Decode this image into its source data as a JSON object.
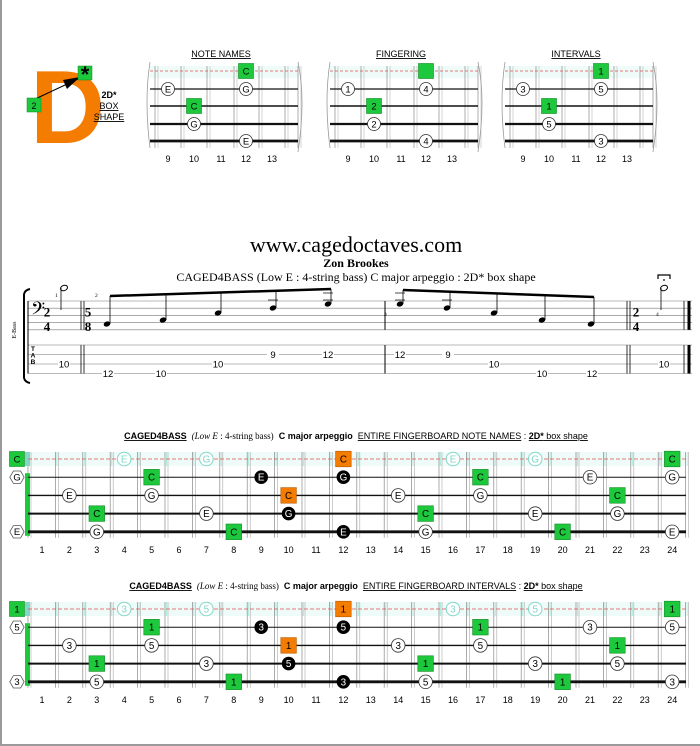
{
  "logo": {
    "letter": "D",
    "star": "*",
    "finger": "2",
    "shape_label": "2D*",
    "shape_sub1": "BOX",
    "shape_sub2": "SHAPE",
    "colors": {
      "letter": "#f47c00",
      "box": "#1ec83c"
    }
  },
  "mini_diagrams": {
    "frets": [
      "9",
      "10",
      "11",
      "12",
      "13"
    ],
    "panels": [
      {
        "title": "NOTE NAMES",
        "marks": [
          {
            "fret": 12,
            "string": 0,
            "text": "C",
            "style": "green"
          },
          {
            "fret": 9,
            "string": 1,
            "text": "E",
            "style": "circle"
          },
          {
            "fret": 12,
            "string": 1,
            "text": "G",
            "style": "circle"
          },
          {
            "fret": 10,
            "string": 2,
            "text": "C",
            "style": "green"
          },
          {
            "fret": 10,
            "string": 3,
            "text": "G",
            "style": "circle"
          },
          {
            "fret": 12,
            "string": 4,
            "text": "E",
            "style": "circle"
          }
        ]
      },
      {
        "title": "FINGERING",
        "marks": [
          {
            "fret": 12,
            "string": 0,
            "text": "",
            "style": "green"
          },
          {
            "fret": 9,
            "string": 1,
            "text": "1",
            "style": "circle"
          },
          {
            "fret": 12,
            "string": 1,
            "text": "4",
            "style": "circle"
          },
          {
            "fret": 10,
            "string": 2,
            "text": "2",
            "style": "green"
          },
          {
            "fret": 10,
            "string": 3,
            "text": "2",
            "style": "circle"
          },
          {
            "fret": 12,
            "string": 4,
            "text": "4",
            "style": "circle"
          }
        ]
      },
      {
        "title": "INTERVALS",
        "marks": [
          {
            "fret": 12,
            "string": 0,
            "text": "1",
            "style": "green"
          },
          {
            "fret": 9,
            "string": 1,
            "text": "3",
            "style": "circle"
          },
          {
            "fret": 12,
            "string": 1,
            "text": "5",
            "style": "circle"
          },
          {
            "fret": 10,
            "string": 2,
            "text": "1",
            "style": "green"
          },
          {
            "fret": 10,
            "string": 3,
            "text": "5",
            "style": "circle"
          },
          {
            "fret": 12,
            "string": 4,
            "text": "3",
            "style": "circle"
          }
        ]
      }
    ]
  },
  "header": {
    "site": "www.cagedoctaves.com",
    "author": "Zon Brookes",
    "subtitle": "CAGED4BASS (Low E : 4-string bass) C major arpeggio : 2D* box shape"
  },
  "score": {
    "instrument": "E-Bass",
    "tab_clef": [
      "T",
      "A",
      "B"
    ],
    "measures": [
      {
        "number": "1",
        "time": [
          "2",
          "4"
        ],
        "tab": [
          {
            "string": 2,
            "fret": "10"
          }
        ]
      },
      {
        "number": "2",
        "time": [
          "5",
          "8"
        ],
        "tab": [
          {
            "string": 3,
            "fret": "12"
          },
          {
            "string": 3,
            "fret": "10"
          },
          {
            "string": 2,
            "fret": "10"
          },
          {
            "string": 1,
            "fret": "9"
          },
          {
            "string": 1,
            "fret": "12"
          }
        ]
      },
      {
        "number": "3",
        "time": null,
        "tab": [
          {
            "string": 1,
            "fret": "12"
          },
          {
            "string": 1,
            "fret": "9"
          },
          {
            "string": 2,
            "fret": "10"
          },
          {
            "string": 3,
            "fret": "10"
          },
          {
            "string": 3,
            "fret": "12"
          }
        ]
      },
      {
        "number": "4",
        "time": [
          "2",
          "4"
        ],
        "tab": [
          {
            "string": 2,
            "fret": "10"
          }
        ]
      }
    ]
  },
  "fingerboards": [
    {
      "title_parts": {
        "a": "CAGED4BASS",
        "b": "(Low E",
        "c": " : 4-string bass)",
        "d": "C major arpeggio",
        "e": "ENTIRE FINGERBOARD  NOTE NAMES",
        "f": " : ",
        "g": "2D*",
        "h": " box shape"
      },
      "open": [
        {
          "string": 0,
          "text": "C",
          "style": "green"
        },
        {
          "string": 1,
          "text": "G",
          "style": "hex"
        },
        {
          "string": 4,
          "text": "E",
          "style": "hex"
        }
      ],
      "marks": [
        {
          "fret": 4,
          "string": 0,
          "text": "E",
          "style": "ghost"
        },
        {
          "fret": 7,
          "string": 0,
          "text": "G",
          "style": "ghost"
        },
        {
          "fret": 12,
          "string": 0,
          "text": "C",
          "style": "orange"
        },
        {
          "fret": 16,
          "string": 0,
          "text": "E",
          "style": "ghost"
        },
        {
          "fret": 19,
          "string": 0,
          "text": "G",
          "style": "ghost"
        },
        {
          "fret": 24,
          "string": 0,
          "text": "C",
          "style": "green"
        },
        {
          "fret": 5,
          "string": 1,
          "text": "C",
          "style": "green"
        },
        {
          "fret": 9,
          "string": 1,
          "text": "E",
          "style": "black"
        },
        {
          "fret": 12,
          "string": 1,
          "text": "G",
          "style": "black"
        },
        {
          "fret": 17,
          "string": 1,
          "text": "C",
          "style": "green"
        },
        {
          "fret": 21,
          "string": 1,
          "text": "E",
          "style": "circle"
        },
        {
          "fret": 24,
          "string": 1,
          "text": "G",
          "style": "circle"
        },
        {
          "fret": 2,
          "string": 2,
          "text": "E",
          "style": "circle"
        },
        {
          "fret": 5,
          "string": 2,
          "text": "G",
          "style": "circle"
        },
        {
          "fret": 10,
          "string": 2,
          "text": "C",
          "style": "orange"
        },
        {
          "fret": 14,
          "string": 2,
          "text": "E",
          "style": "circle"
        },
        {
          "fret": 17,
          "string": 2,
          "text": "G",
          "style": "circle"
        },
        {
          "fret": 22,
          "string": 2,
          "text": "C",
          "style": "green"
        },
        {
          "fret": 3,
          "string": 3,
          "text": "C",
          "style": "green"
        },
        {
          "fret": 7,
          "string": 3,
          "text": "E",
          "style": "circle"
        },
        {
          "fret": 10,
          "string": 3,
          "text": "G",
          "style": "black"
        },
        {
          "fret": 15,
          "string": 3,
          "text": "C",
          "style": "green"
        },
        {
          "fret": 19,
          "string": 3,
          "text": "E",
          "style": "circle"
        },
        {
          "fret": 22,
          "string": 3,
          "text": "G",
          "style": "circle"
        },
        {
          "fret": 3,
          "string": 4,
          "text": "G",
          "style": "circle"
        },
        {
          "fret": 8,
          "string": 4,
          "text": "C",
          "style": "green"
        },
        {
          "fret": 12,
          "string": 4,
          "text": "E",
          "style": "black"
        },
        {
          "fret": 15,
          "string": 4,
          "text": "G",
          "style": "circle"
        },
        {
          "fret": 20,
          "string": 4,
          "text": "C",
          "style": "green"
        },
        {
          "fret": 24,
          "string": 4,
          "text": "E",
          "style": "circle"
        }
      ]
    },
    {
      "title_parts": {
        "a": "CAGED4BASS",
        "b": "(Low E",
        "c": " : 4-string bass)",
        "d": "C major arpeggio",
        "e": "ENTIRE FINGERBOARD  INTERVALS",
        "f": " : ",
        "g": "2D*",
        "h": " box shape"
      },
      "open": [
        {
          "string": 0,
          "text": "1",
          "style": "green"
        },
        {
          "string": 1,
          "text": "5",
          "style": "hex"
        },
        {
          "string": 4,
          "text": "3",
          "style": "hex"
        }
      ],
      "marks": [
        {
          "fret": 4,
          "string": 0,
          "text": "3",
          "style": "ghost"
        },
        {
          "fret": 7,
          "string": 0,
          "text": "5",
          "style": "ghost"
        },
        {
          "fret": 12,
          "string": 0,
          "text": "1",
          "style": "orange"
        },
        {
          "fret": 16,
          "string": 0,
          "text": "3",
          "style": "ghost"
        },
        {
          "fret": 19,
          "string": 0,
          "text": "5",
          "style": "ghost"
        },
        {
          "fret": 24,
          "string": 0,
          "text": "1",
          "style": "green"
        },
        {
          "fret": 5,
          "string": 1,
          "text": "1",
          "style": "green"
        },
        {
          "fret": 9,
          "string": 1,
          "text": "3",
          "style": "black"
        },
        {
          "fret": 12,
          "string": 1,
          "text": "5",
          "style": "black"
        },
        {
          "fret": 17,
          "string": 1,
          "text": "1",
          "style": "green"
        },
        {
          "fret": 21,
          "string": 1,
          "text": "3",
          "style": "circle"
        },
        {
          "fret": 24,
          "string": 1,
          "text": "5",
          "style": "circle"
        },
        {
          "fret": 2,
          "string": 2,
          "text": "3",
          "style": "circle"
        },
        {
          "fret": 5,
          "string": 2,
          "text": "5",
          "style": "circle"
        },
        {
          "fret": 10,
          "string": 2,
          "text": "1",
          "style": "orange"
        },
        {
          "fret": 14,
          "string": 2,
          "text": "3",
          "style": "circle"
        },
        {
          "fret": 17,
          "string": 2,
          "text": "5",
          "style": "circle"
        },
        {
          "fret": 22,
          "string": 2,
          "text": "1",
          "style": "green"
        },
        {
          "fret": 3,
          "string": 3,
          "text": "1",
          "style": "green"
        },
        {
          "fret": 7,
          "string": 3,
          "text": "3",
          "style": "circle"
        },
        {
          "fret": 10,
          "string": 3,
          "text": "5",
          "style": "black"
        },
        {
          "fret": 15,
          "string": 3,
          "text": "1",
          "style": "green"
        },
        {
          "fret": 19,
          "string": 3,
          "text": "3",
          "style": "circle"
        },
        {
          "fret": 22,
          "string": 3,
          "text": "5",
          "style": "circle"
        },
        {
          "fret": 3,
          "string": 4,
          "text": "5",
          "style": "circle"
        },
        {
          "fret": 8,
          "string": 4,
          "text": "1",
          "style": "green"
        },
        {
          "fret": 12,
          "string": 4,
          "text": "3",
          "style": "black"
        },
        {
          "fret": 15,
          "string": 4,
          "text": "5",
          "style": "circle"
        },
        {
          "fret": 20,
          "string": 4,
          "text": "1",
          "style": "green"
        },
        {
          "fret": 24,
          "string": 4,
          "text": "3",
          "style": "circle"
        }
      ]
    }
  ],
  "fret_numbers": [
    "1",
    "2",
    "3",
    "4",
    "5",
    "6",
    "7",
    "8",
    "9",
    "10",
    "11",
    "12",
    "13",
    "14",
    "15",
    "16",
    "17",
    "18",
    "19",
    "20",
    "21",
    "22",
    "23",
    "24"
  ],
  "colors": {
    "green": "#1ec83c",
    "orange": "#f47c00",
    "ghost": "#7fd8c8",
    "dash": "#e05050",
    "black": "#000000"
  }
}
